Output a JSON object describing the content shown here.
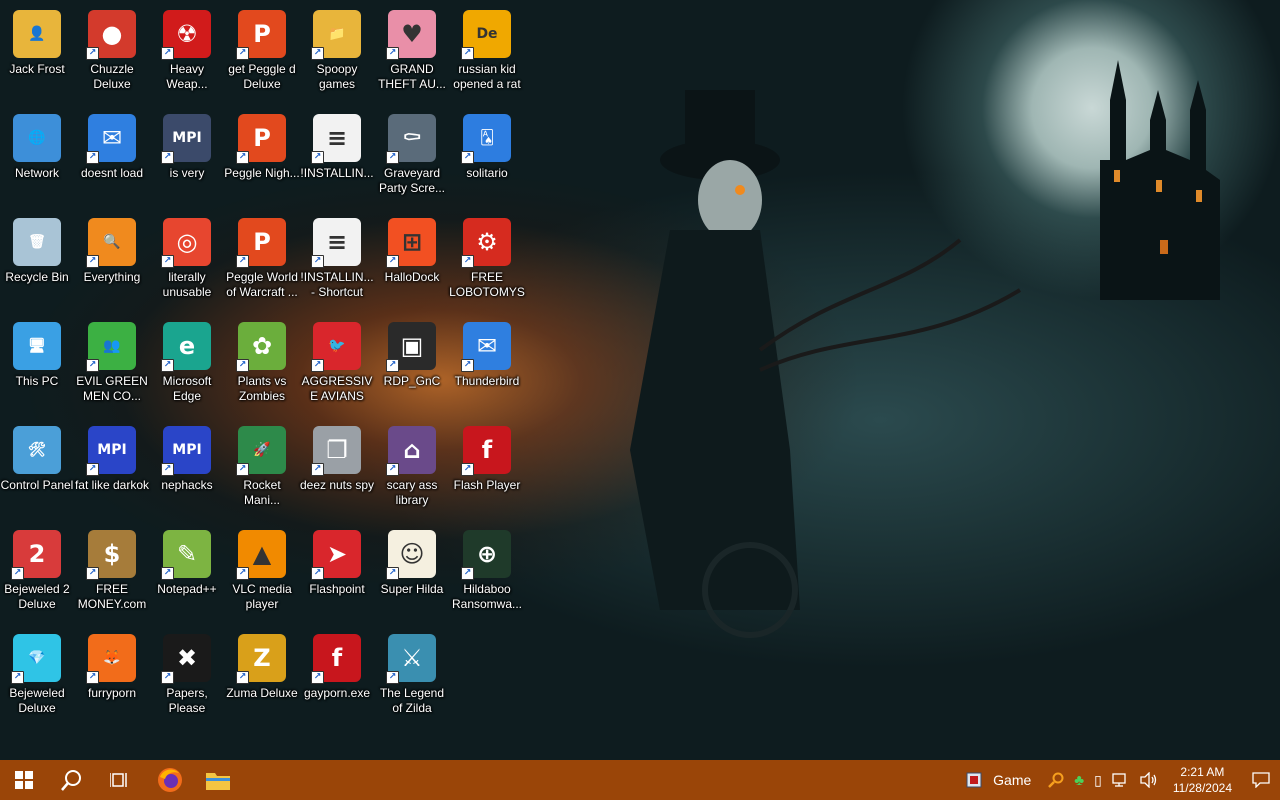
{
  "desktop_icons": [
    {
      "label": "Jack Frost",
      "icon": "user-folder-icon",
      "color": "#e8b53b"
    },
    {
      "label": "Network",
      "icon": "network-icon",
      "color": "#3d8fd9"
    },
    {
      "label": "Recycle Bin",
      "icon": "recycle-bin-icon",
      "color": "#a9c4d6"
    },
    {
      "label": "This PC",
      "icon": "computer-icon",
      "color": "#3aa0e4"
    },
    {
      "label": "Control Panel",
      "icon": "control-panel-icon",
      "color": "#4b9fd8"
    },
    {
      "label": "Bejeweled 2 Deluxe",
      "icon": "bejeweled2-icon",
      "color": "#d83b3b"
    },
    {
      "label": "Bejeweled Deluxe",
      "icon": "diamond-icon",
      "color": "#2fc4e6"
    },
    {
      "label": "Chuzzle Deluxe",
      "icon": "chuzzle-icon",
      "color": "#d33a2c"
    },
    {
      "label": "doesnt load",
      "icon": "thunderbird-icon",
      "color": "#2f7fe0"
    },
    {
      "label": "Everything",
      "icon": "magnifier-icon",
      "color": "#f08a1e"
    },
    {
      "label": "EVIL GREEN MEN CO...",
      "icon": "green-men-icon",
      "color": "#3cb043"
    },
    {
      "label": "fat like darkok",
      "icon": "mpi-icon",
      "color": "#2a45c8"
    },
    {
      "label": "FREE MONEY.com",
      "icon": "money-bag-icon",
      "color": "#a67c3a"
    },
    {
      "label": "furryporn",
      "icon": "firefox-icon",
      "color": "#f26c1a"
    },
    {
      "label": "Heavy Weap...",
      "icon": "radiation-icon",
      "color": "#d11b1b"
    },
    {
      "label": "is very",
      "icon": "mpi-shield-icon",
      "color": "#3b4a6a"
    },
    {
      "label": "literally unusable",
      "icon": "chrome-icon",
      "color": "#e7462f"
    },
    {
      "label": "Microsoft Edge",
      "icon": "edge-icon",
      "color": "#1aa58f"
    },
    {
      "label": "nephacks",
      "icon": "mpi-icon",
      "color": "#2a45c8"
    },
    {
      "label": "Notepad++",
      "icon": "notepad-icon",
      "color": "#7db442"
    },
    {
      "label": "Papers, Please",
      "icon": "papers-please-icon",
      "color": "#1a1a1a"
    },
    {
      "label": "get Peggle d Deluxe",
      "icon": "peggle-icon",
      "color": "#e2491e"
    },
    {
      "label": "Peggle Nigh...",
      "icon": "peggle-icon",
      "color": "#e2491e"
    },
    {
      "label": "Peggle World of Warcraft ...",
      "icon": "peggle-icon",
      "color": "#e2491e"
    },
    {
      "label": "Plants vs Zombies",
      "icon": "flower-icon",
      "color": "#6bae3c"
    },
    {
      "label": "Rocket Mani...",
      "icon": "rocket-icon",
      "color": "#2d8a4a"
    },
    {
      "label": "VLC media player",
      "icon": "vlc-cone-icon",
      "color": "#f18a00"
    },
    {
      "label": "Zuma Deluxe",
      "icon": "zuma-icon",
      "color": "#d9a01a"
    },
    {
      "label": "Spoopy games",
      "icon": "folder-icon",
      "color": "#e8b53b"
    },
    {
      "label": "!INSTALLIN...",
      "icon": "document-icon",
      "color": "#f2f2f2"
    },
    {
      "label": "!INSTALLIN... - Shortcut",
      "icon": "document-icon",
      "color": "#f2f2f2"
    },
    {
      "label": "AGGRESSIVE AVIANS",
      "icon": "angry-bird-icon",
      "color": "#d9262c"
    },
    {
      "label": "deez nuts spy",
      "icon": "windows-stack-icon",
      "color": "#9aa0a6"
    },
    {
      "label": "Flashpoint",
      "icon": "flashpoint-icon",
      "color": "#d9262c"
    },
    {
      "label": "gayporn.exe",
      "icon": "flash-icon",
      "color": "#c8161d"
    },
    {
      "label": "GRAND THEFT AU...",
      "icon": "anime-girl-icon",
      "color": "#e98fa8"
    },
    {
      "label": "Graveyard Party Scre...",
      "icon": "graveyard-icon",
      "color": "#5a6b7a"
    },
    {
      "label": "HalloDock",
      "icon": "windows-flag-icon",
      "color": "#f25022"
    },
    {
      "label": "RDP_GnC",
      "icon": "rdp-icon",
      "color": "#2a2a2a"
    },
    {
      "label": "scary ass library",
      "icon": "library-icon",
      "color": "#6a4a8a"
    },
    {
      "label": "Super Hilda",
      "icon": "pixel-hilda-icon",
      "color": "#f5f0e0"
    },
    {
      "label": "The Legend of Zilda",
      "icon": "zilda-icon",
      "color": "#3a8fb0"
    },
    {
      "label": "russian kid opened a rat",
      "icon": "de-logo-icon",
      "color": "#f0a800"
    },
    {
      "label": "solitario",
      "icon": "solitaire-icon",
      "color": "#2d7de0"
    },
    {
      "label": "FREE LOBOTOMYS",
      "icon": "lobotomy-icon",
      "color": "#d62b1f"
    },
    {
      "label": "Thunderbird",
      "icon": "thunderbird-icon",
      "color": "#2f7fe0"
    },
    {
      "label": "Flash Player",
      "icon": "flash-icon",
      "color": "#c8161d"
    },
    {
      "label": "Hildaboo Ransomwa...",
      "icon": "yashma-icon",
      "color": "#1f3a2a"
    }
  ],
  "icon_glyphs": [
    "👤",
    "🌐",
    "🗑",
    "🖥",
    "🛠",
    "2",
    "💎",
    "●",
    "✉",
    "🔍",
    "👥",
    "MPI",
    "$",
    "🦊",
    "☢",
    "MPI",
    "◎",
    "e",
    "MPI",
    "✎",
    "✖",
    "P",
    "P",
    "P",
    "✿",
    "🚀",
    "▲",
    "Z",
    "📁",
    "≡",
    "≡",
    "🐦",
    "❐",
    "➤",
    "f",
    "♥",
    "⚰",
    "⊞",
    "▣",
    "⌂",
    "☺",
    "⚔",
    "De",
    "🂡",
    "⚙",
    "✉",
    "f",
    "⊕"
  ],
  "taskbar": {
    "start_label": "Start",
    "search_label": "Search",
    "task_view_label": "Task View",
    "pinned": [
      {
        "name": "Firefox",
        "icon": "firefox-icon"
      },
      {
        "name": "File Explorer",
        "icon": "file-explorer-icon"
      }
    ],
    "tray_game_label": "Game",
    "time": "2:21 AM",
    "date": "11/28/2024"
  },
  "colors": {
    "taskbar": "#9a4508",
    "accent": "#f08a1e"
  }
}
